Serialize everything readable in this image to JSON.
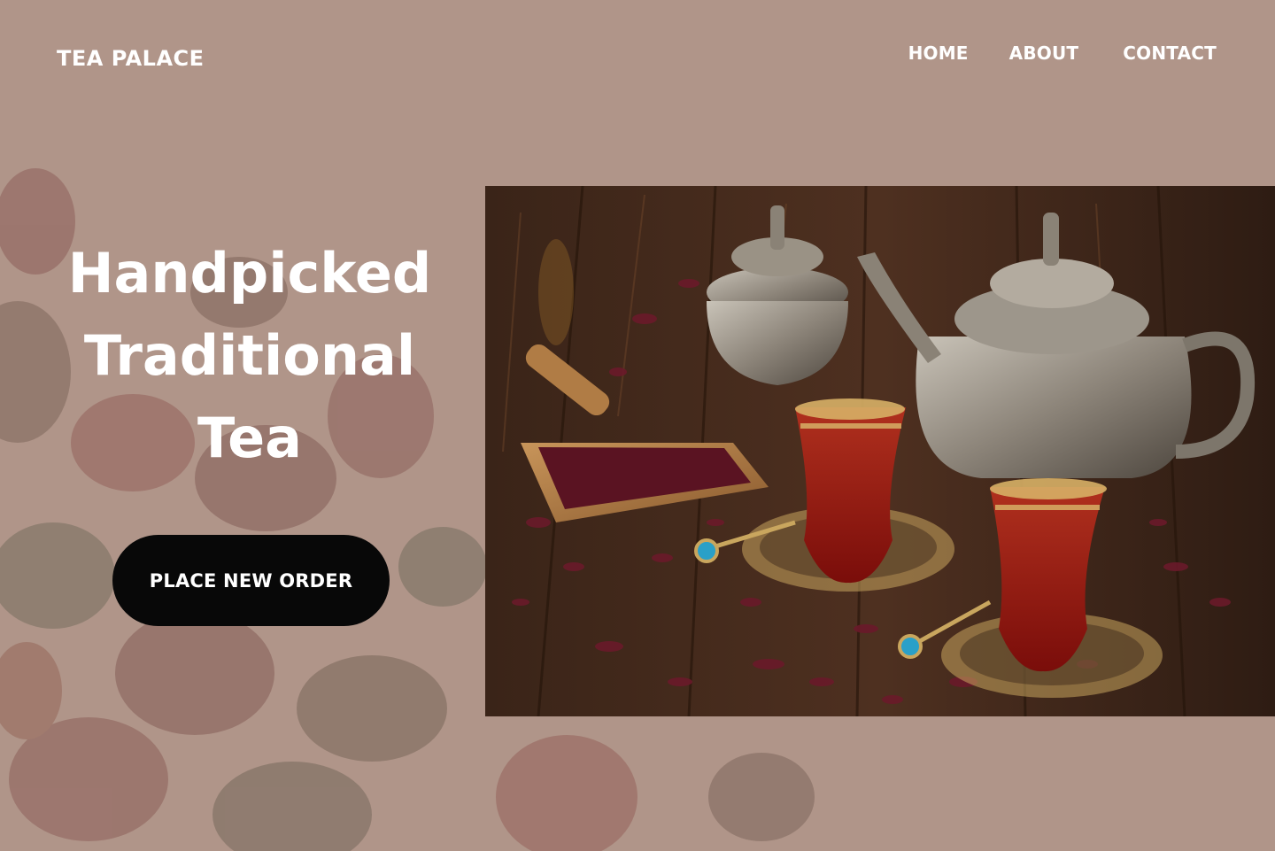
{
  "brand": {
    "name": "TEA PALACE"
  },
  "nav": {
    "items": [
      {
        "label": "HOME"
      },
      {
        "label": "ABOUT"
      },
      {
        "label": "CONTACT"
      }
    ]
  },
  "hero": {
    "title_lines": [
      "Handpicked",
      "Traditional",
      "Tea"
    ],
    "cta_label": "PLACE NEW ORDER",
    "photo_subject": "tea-set-photo"
  },
  "colors": {
    "background": "#b09589",
    "cta_background": "#080808",
    "text": "#ffffff"
  }
}
